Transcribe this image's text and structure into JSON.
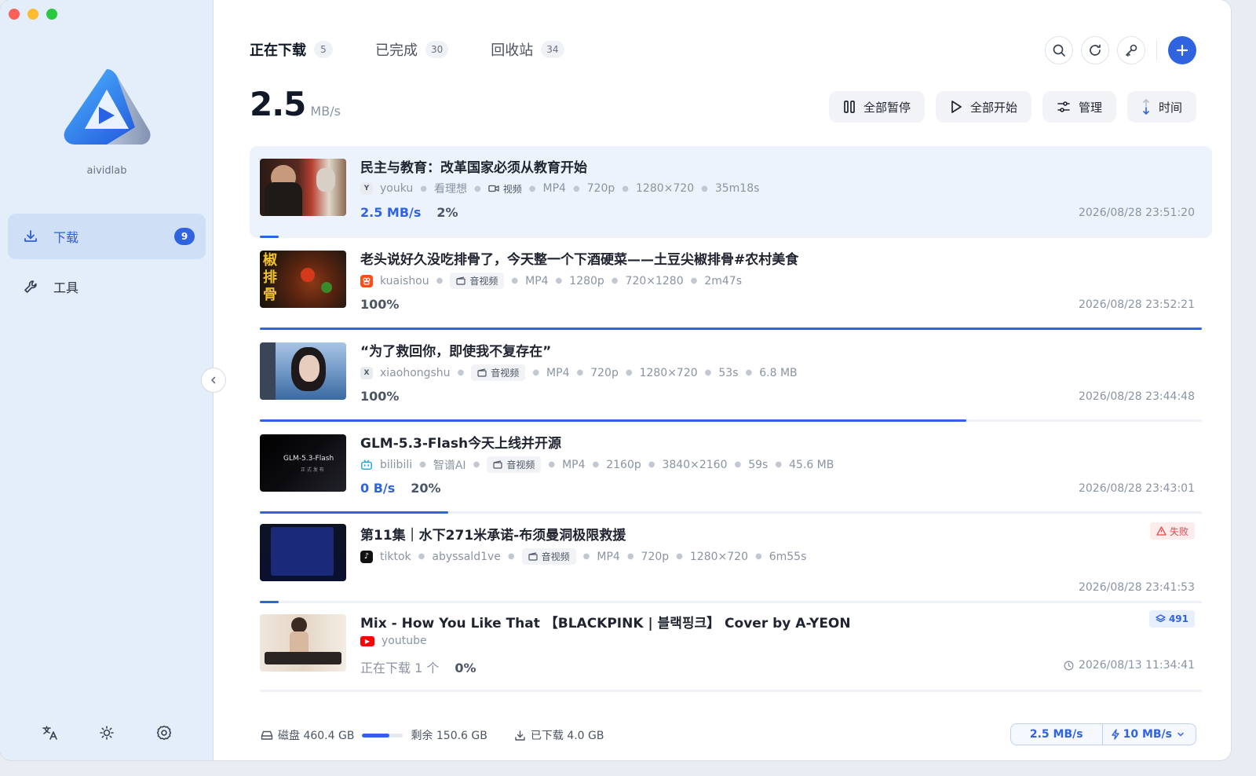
{
  "app": {
    "name": "aividlab"
  },
  "sidebar": {
    "items": [
      {
        "label": "下载",
        "badge": "9",
        "icon": "download-icon",
        "active": true
      },
      {
        "label": "工具",
        "icon": "wrench-icon",
        "active": false
      }
    ],
    "bottom_icons": [
      "translate-icon",
      "sun-icon",
      "gear-icon"
    ]
  },
  "tabs": [
    {
      "label": "正在下载",
      "count": "5",
      "active": true
    },
    {
      "label": "已完成",
      "count": "30",
      "active": false
    },
    {
      "label": "回收站",
      "count": "34",
      "active": false
    }
  ],
  "top_actions": [
    "search-icon",
    "refresh-icon",
    "key-icon",
    "plus-icon"
  ],
  "speed": {
    "value": "2.5",
    "unit": "MB/s"
  },
  "toolbar": {
    "pause_all": "全部暂停",
    "start_all": "全部开始",
    "manage": "管理",
    "sort": "时间"
  },
  "downloads": [
    {
      "title": "民主与教育：改革国家必须从教育开始",
      "source": "youku",
      "source_icon": "Y",
      "meta": [
        "看理想"
      ],
      "tag": "视频",
      "specs": [
        "MP4",
        "720p",
        "1280×720",
        "35m18s"
      ],
      "speed": "2.5 MB/s",
      "percent": "2%",
      "progress": 0.02,
      "time": "2026/08/28 23:51:20"
    },
    {
      "title": "老头说好久没吃排骨了，今天整一个下酒硬菜——土豆尖椒排骨#农村美食",
      "source": "kuaishou",
      "source_icon": "ks",
      "meta": [],
      "tag": "音视频",
      "specs": [
        "MP4",
        "1280p",
        "720×1280",
        "2m47s"
      ],
      "percent": "100%",
      "progress": 1.0,
      "time": "2026/08/28 23:52:21"
    },
    {
      "title": "“为了救回你，即使我不复存在”",
      "source": "xiaohongshu",
      "source_icon": "X",
      "meta": [],
      "tag": "音视频",
      "specs": [
        "MP4",
        "720p",
        "1280×720",
        "53s",
        "6.8 MB"
      ],
      "percent": "100%",
      "progress": 0.75,
      "time": "2026/08/28 23:44:48"
    },
    {
      "title": "GLM-5.3-Flash今天上线并开源",
      "source": "bilibili",
      "source_icon": "tv",
      "meta": [
        "智谱AI"
      ],
      "tag": "音视频",
      "specs": [
        "MP4",
        "2160p",
        "3840×2160",
        "59s",
        "45.6 MB"
      ],
      "speed": "0 B/s",
      "percent": "20%",
      "progress": 0.2,
      "time": "2026/08/28 23:43:01",
      "thumb_text": "GLM-5.3-Flash",
      "thumb_sub": "正 式 发 布"
    },
    {
      "title": "第11集｜水下271米承诺-布须曼洞极限救援",
      "source": "tiktok",
      "source_icon": "♪",
      "meta": [
        "abyssald1ve"
      ],
      "tag": "音视频",
      "specs": [
        "MP4",
        "720p",
        "1280×720",
        "6m55s"
      ],
      "status": "失败",
      "progress": 0.012,
      "time": "2026/08/28 23:41:53"
    },
    {
      "title": "Mix - How You Like That 【BLACKPINK | 블랙핑크】 Cover by A-YEON",
      "source": "youtube",
      "source_icon": "▶",
      "meta": [],
      "tag": null,
      "specs": [],
      "pending": "正在下载 1 个",
      "percent": "0%",
      "progress": 0,
      "count_badge": "491",
      "time": "2026/08/13 11:34:41"
    }
  ],
  "footer": {
    "disk": "磁盘 460.4 GB",
    "disk_used": 0.67,
    "remaining": "剩余 150.6 GB",
    "downloaded": "已下载 4.0 GB",
    "current_speed": "2.5 MB/s",
    "limit": "10 MB/s"
  },
  "colors": {
    "accent": "#2f63e0",
    "fail": "#e5484d"
  }
}
